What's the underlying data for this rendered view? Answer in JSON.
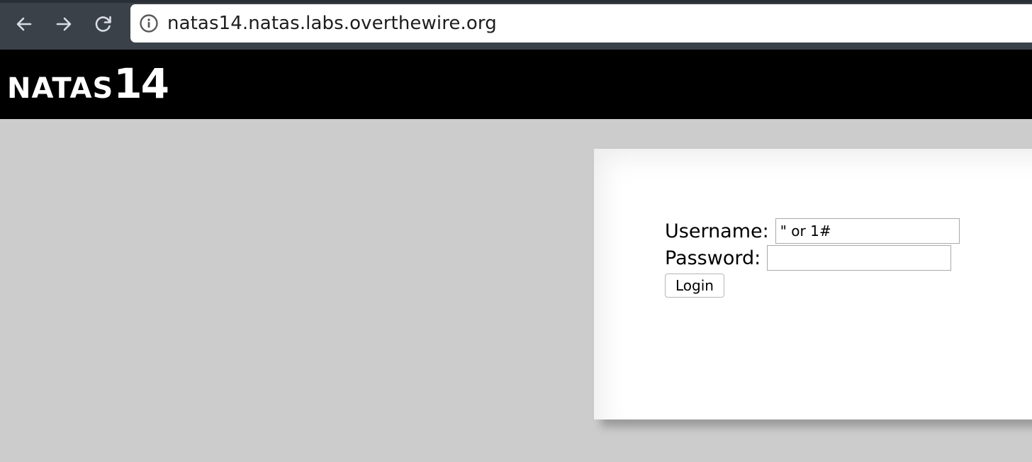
{
  "browser": {
    "url": "natas14.natas.labs.overthewire.org",
    "icons": {
      "back": "back-arrow-icon",
      "forward": "forward-arrow-icon",
      "reload": "reload-icon",
      "info": "info-icon"
    }
  },
  "site": {
    "logo_word": "NATAS",
    "logo_number": "14"
  },
  "form": {
    "username_label": "Username:",
    "username_value": "\" or 1#",
    "password_label": "Password:",
    "password_value": "",
    "login_label": "Login"
  },
  "colors": {
    "chrome": "#3b4149",
    "header": "#000000",
    "background": "#cccccc",
    "card": "#ffffff"
  }
}
